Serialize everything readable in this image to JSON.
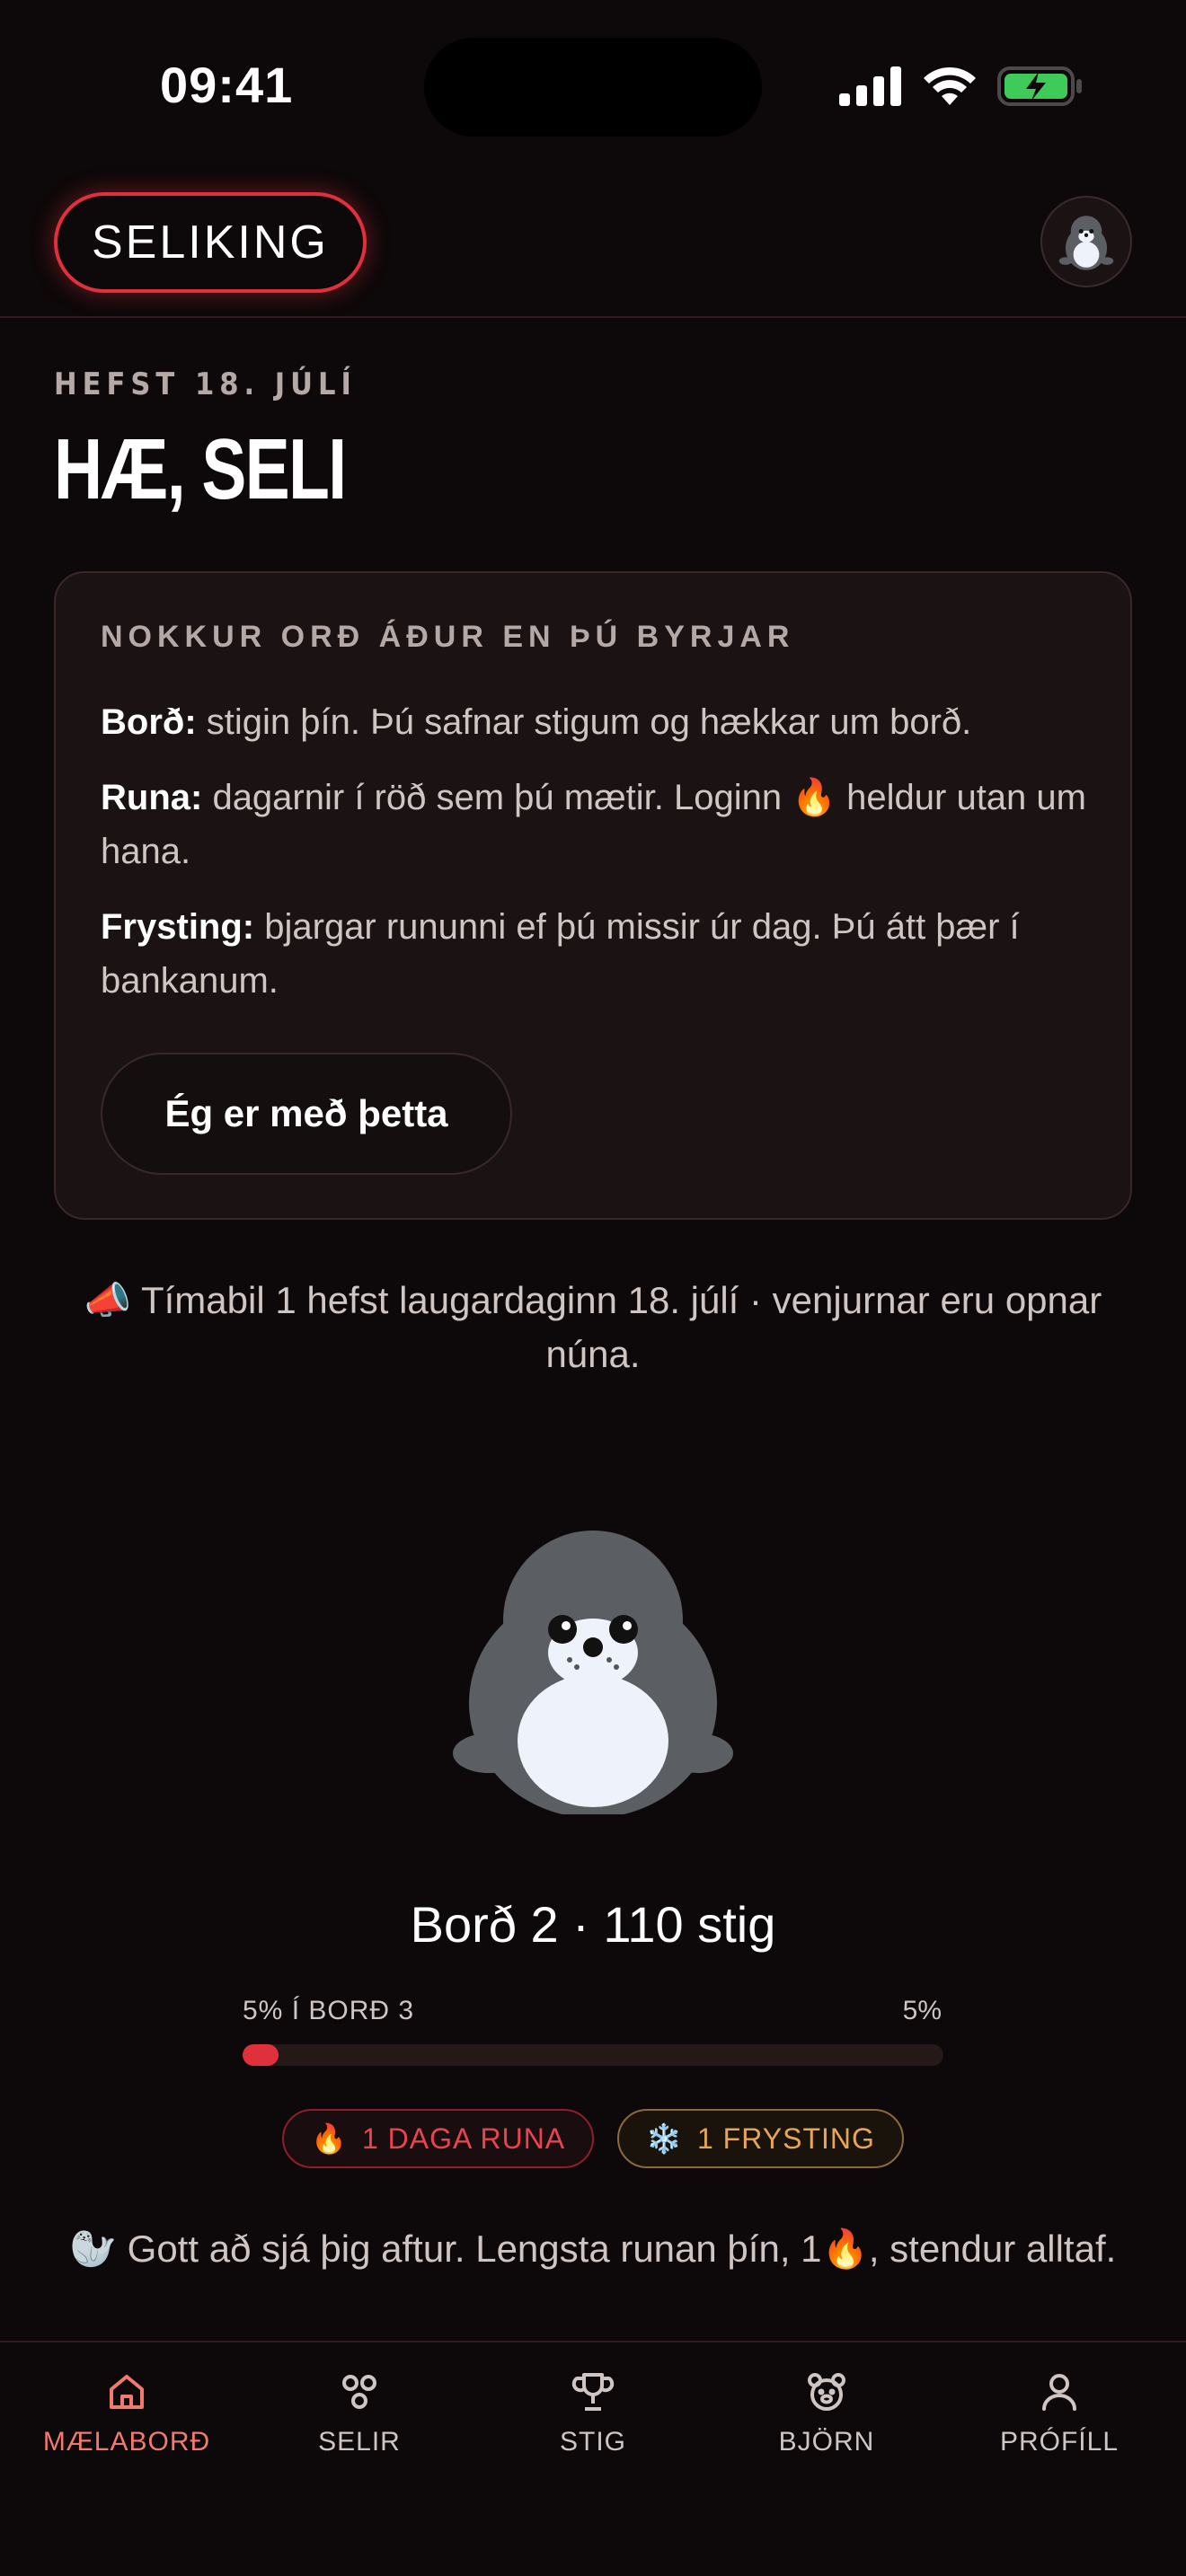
{
  "status_bar": {
    "time": "09:41"
  },
  "header": {
    "brand": "SELIKING"
  },
  "greeting": {
    "eyebrow": "HEFST 18. JÚLÍ",
    "title": "HÆ, SELI"
  },
  "intro_card": {
    "eyebrow": "NOKKUR ORÐ ÁÐUR EN ÞÚ BYRJAR",
    "items": [
      {
        "term": "Borð:",
        "text": " stigin þín. Þú safnar stigum og hækkar um borð."
      },
      {
        "term": "Runa:",
        "text_before": " dagarnir í röð sem þú mætir. Loginn ",
        "emoji": "🔥",
        "text_after": " heldur utan um hana."
      },
      {
        "term": "Frysting:",
        "text": " bjargar rununni ef þú missir úr dag. Þú átt þær í bankanum."
      }
    ],
    "button": "Ég er með þetta"
  },
  "announcement": {
    "emoji": "📣",
    "text": " Tímabil 1 hefst laugardaginn 18. júlí · venjurnar eru opnar núna."
  },
  "level": {
    "text": "Borð 2 · 110 stig",
    "progress_label": "5% Í BORÐ 3",
    "progress_percent_text": "5%",
    "progress_value": 0.05
  },
  "badges": {
    "streak": {
      "emoji": "🔥",
      "label": "1 DAGA RUNA"
    },
    "freeze": {
      "emoji": "❄️",
      "label": "1 FRYSTING"
    }
  },
  "welcome": {
    "emoji": "🦭",
    "text_before": " Gott að sjá þig aftur. Lengsta runan þín, 1",
    "emoji2": "🔥",
    "text_after": ", stendur alltaf."
  },
  "nav": {
    "items": [
      {
        "label": "MÆLABORÐ",
        "icon": "home-icon",
        "active": true
      },
      {
        "label": "SELIR",
        "icon": "seals-icon",
        "active": false
      },
      {
        "label": "STIG",
        "icon": "trophy-icon",
        "active": false
      },
      {
        "label": "BJÖRN",
        "icon": "bear-icon",
        "active": false
      },
      {
        "label": "PRÓFÍLL",
        "icon": "profile-icon",
        "active": false
      }
    ]
  },
  "colors": {
    "accent": "#e0303c",
    "nav_active": "#f07a6c",
    "freeze": "#e6a655",
    "background": "#0d0809"
  }
}
